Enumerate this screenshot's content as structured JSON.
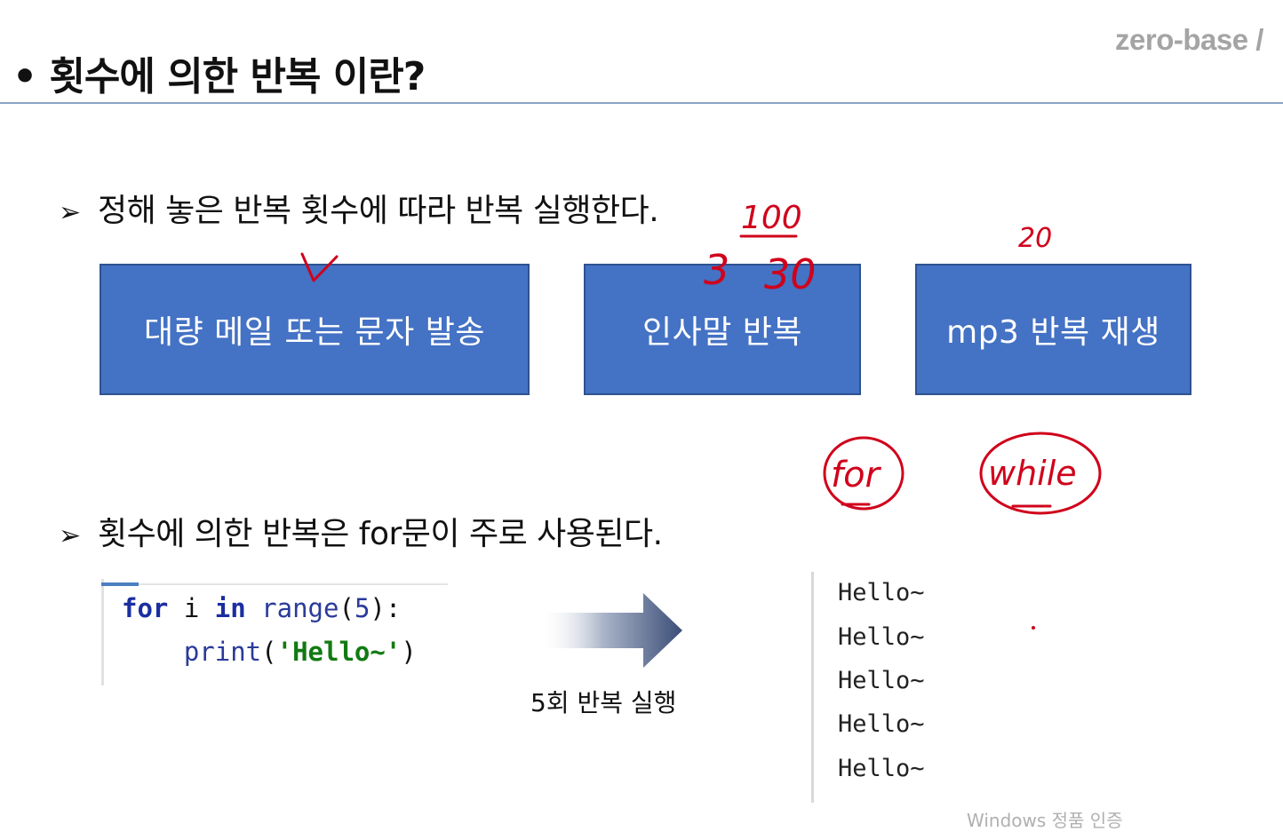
{
  "brand": "zero-base /",
  "title": "• 횟수에 의한 반복 이란?",
  "bullets": {
    "marker": "➢",
    "first": "정해 놓은 반복 횟수에 따라 반복 실행한다.",
    "second": "횟수에 의한 반복은 for문이 주로 사용된다."
  },
  "boxes": [
    {
      "label": "대량 메일 또는 문자 발송"
    },
    {
      "label": "인사말 반복"
    },
    {
      "label": "mp3 반복 재생"
    }
  ],
  "annotations": {
    "n100": "100",
    "n3": "3",
    "n30": "30",
    "n20": "20",
    "for": "for",
    "while": "while"
  },
  "code": {
    "line1": {
      "kw1": "for",
      "var": " i ",
      "kw2": "in",
      "fn": " range",
      "p1": "(",
      "num": "5",
      "p2": "):"
    },
    "line2": {
      "indent": "    ",
      "fn": "print",
      "p1": "(",
      "str": "'Hello~'",
      "p2": ")"
    }
  },
  "caption": "5회 반복 실행",
  "output": [
    "Hello~",
    "Hello~",
    "Hello~",
    "Hello~",
    "Hello~"
  ],
  "watermark": "Windows 정품 인증",
  "colors": {
    "box": "#4472c4",
    "ink": "#d0021b",
    "arrow": "#3b4e78"
  }
}
